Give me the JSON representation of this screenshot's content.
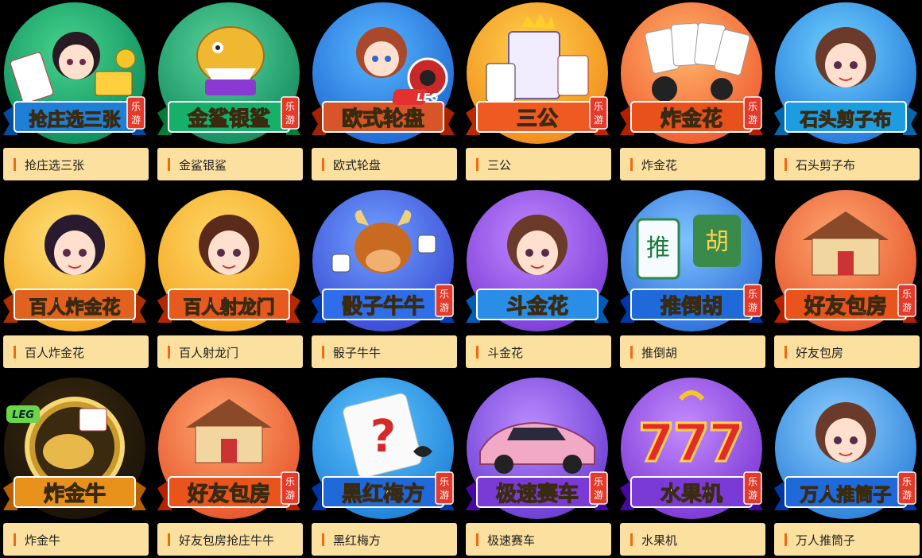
{
  "games": [
    {
      "title": "抢庄选三张",
      "banner": "抢庄选三张",
      "badge": "乐游",
      "c1": "#46d58e",
      "c2": "#0d8a5b",
      "ribbon": "#1f7fd6",
      "icon": "cards"
    },
    {
      "title": "金鲨银鲨",
      "banner": "金鲨银鲨",
      "badge": "乐游",
      "c1": "#59d59b",
      "c2": "#138a5e",
      "ribbon": "#17b06b",
      "icon": "shark"
    },
    {
      "title": "欧式轮盘",
      "banner": "欧式轮盘",
      "badge": "LEG",
      "c1": "#58b7ff",
      "c2": "#1e66d0",
      "ribbon": "#d8552a",
      "icon": "roulette"
    },
    {
      "title": "三公",
      "banner": "三公",
      "badge": "乐游",
      "c1": "#ffd24d",
      "c2": "#f08a1a",
      "ribbon": "#ef5a22",
      "icon": "king"
    },
    {
      "title": "炸金花",
      "banner": "炸金花",
      "badge": "乐游",
      "c1": "#ffb46a",
      "c2": "#ef5a2f",
      "ribbon": "#e8501c",
      "icon": "aces"
    },
    {
      "title": "石头剪子布",
      "banner": "石头剪子布",
      "badge": "",
      "c1": "#71d3ff",
      "c2": "#2377d8",
      "ribbon": "#1d9ce0",
      "icon": "girl"
    },
    {
      "title": "百人炸金花",
      "banner": "百人炸金花",
      "badge": "",
      "c1": "#ffe27a",
      "c2": "#f3a822",
      "ribbon": "#e0621e",
      "icon": "girl"
    },
    {
      "title": "百人射龙门",
      "banner": "百人射龙门",
      "badge": "",
      "c1": "#ffd866",
      "c2": "#f3a622",
      "ribbon": "#e65a1e",
      "icon": "girl"
    },
    {
      "title": "骰子牛牛",
      "banner": "骰子牛牛",
      "badge": "乐游",
      "c1": "#6fa2ff",
      "c2": "#3a48d3",
      "ribbon": "#2f6ee8",
      "icon": "bull"
    },
    {
      "title": "斗金花",
      "banner": "斗金花",
      "badge": "",
      "c1": "#c188ff",
      "c2": "#7a3ad6",
      "ribbon": "#2b8ee6",
      "icon": "girl"
    },
    {
      "title": "推倒胡",
      "banner": "推倒胡",
      "badge": "乐游",
      "c1": "#7fc2ff",
      "c2": "#2d6ed8",
      "ribbon": "#1f69d8",
      "icon": "mahjong"
    },
    {
      "title": "好友包房",
      "banner": "好友包房",
      "badge": "乐游",
      "c1": "#ffa772",
      "c2": "#e55429",
      "ribbon": "#e8541c",
      "icon": "house"
    },
    {
      "title": "炸金牛",
      "banner": "炸金牛",
      "badge": "LEG",
      "c1": "#3a2a10",
      "c2": "#1a1208",
      "ribbon": "#e8921c",
      "icon": "goldbull"
    },
    {
      "title": "好友包房抢庄牛牛",
      "banner": "好友包房",
      "badge": "乐游",
      "c1": "#ffa772",
      "c2": "#e55429",
      "ribbon": "#e8541c",
      "icon": "house"
    },
    {
      "title": "黑红梅方",
      "banner": "黑红梅方",
      "badge": "乐游",
      "c1": "#5fc6ff",
      "c2": "#1e7fd6",
      "ribbon": "#1f69d8",
      "icon": "question"
    },
    {
      "title": "极速赛车",
      "banner": "极速赛车",
      "badge": "乐游",
      "c1": "#b98cff",
      "c2": "#6a3ad0",
      "ribbon": "#7a3ad6",
      "icon": "car"
    },
    {
      "title": "水果机",
      "banner": "水果机",
      "badge": "乐游",
      "c1": "#c48cff",
      "c2": "#7a36d2",
      "ribbon": "#7a3ad6",
      "icon": "seven"
    },
    {
      "title": "万人推筒子",
      "banner": "万人推筒子",
      "badge": "乐游",
      "c1": "#8fd0ff",
      "c2": "#2a7fd8",
      "ribbon": "#1f69d8",
      "icon": "girl"
    }
  ]
}
